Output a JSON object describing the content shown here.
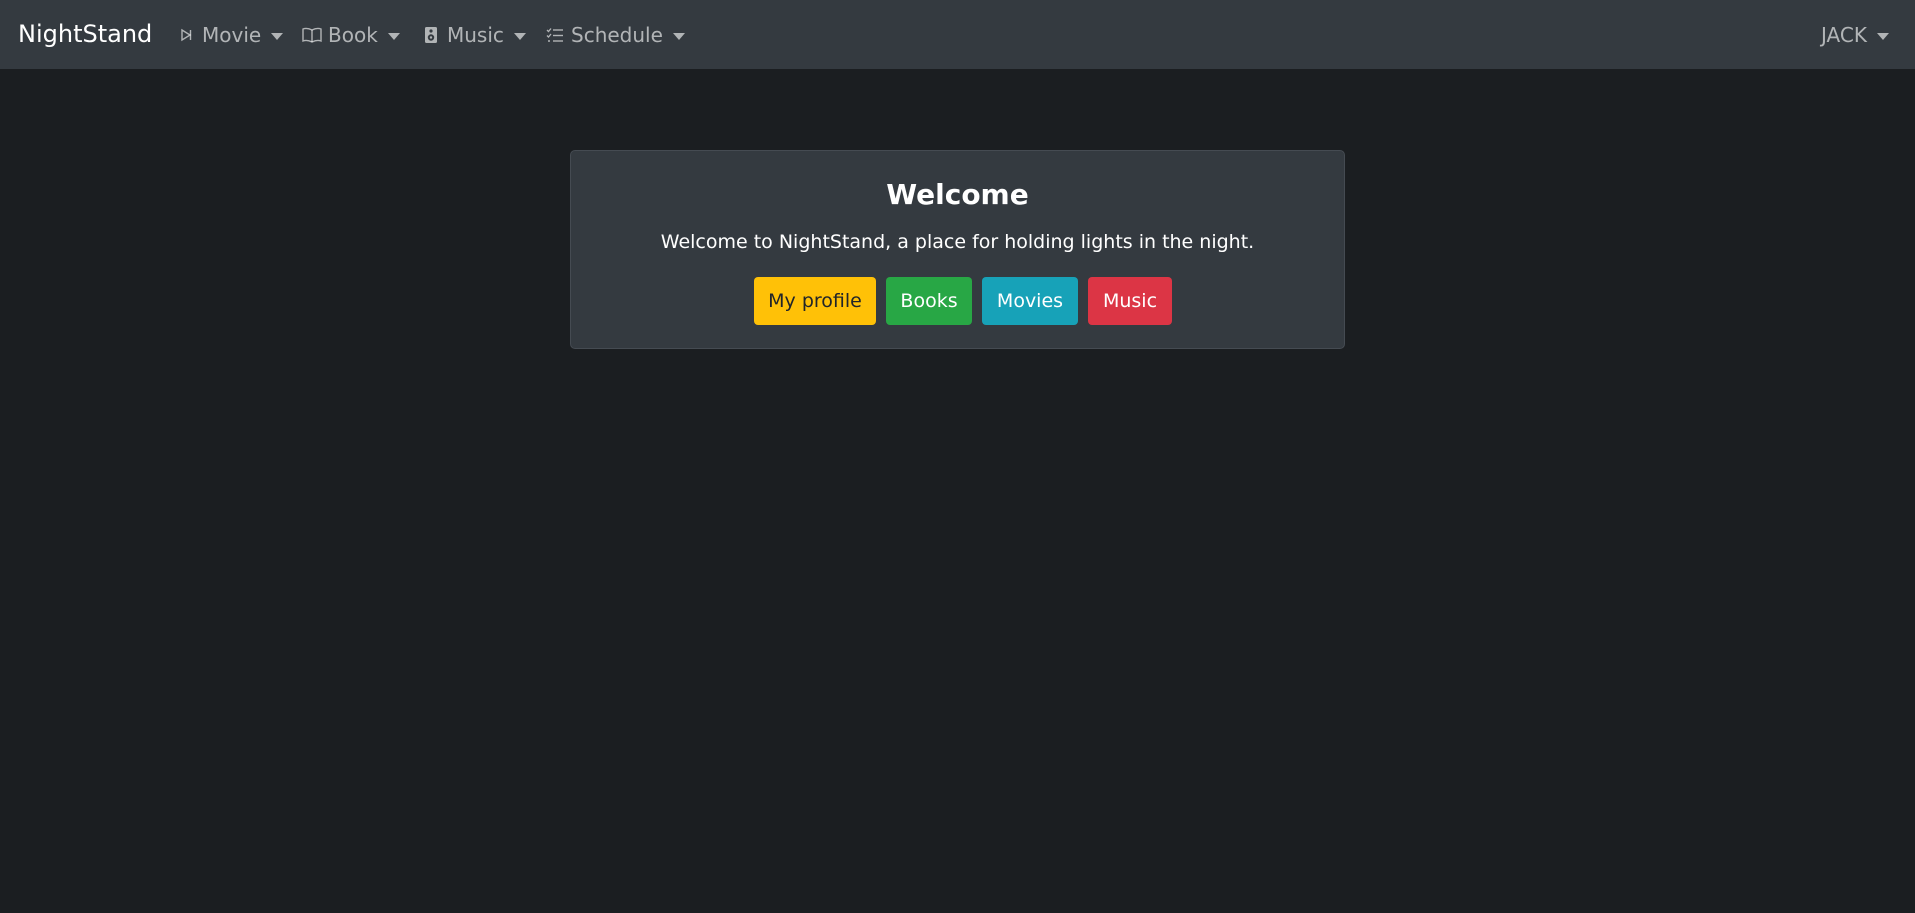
{
  "navbar": {
    "brand": "NightStand",
    "items": [
      {
        "label": "Movie",
        "icon": "play-icon"
      },
      {
        "label": "Book",
        "icon": "book-icon"
      },
      {
        "label": "Music",
        "icon": "speaker-icon"
      },
      {
        "label": "Schedule",
        "icon": "list-icon"
      }
    ],
    "user": "JACK"
  },
  "welcome": {
    "title": "Welcome",
    "text": "Welcome to NightStand, a place for holding lights in the night.",
    "buttons": {
      "profile": "My profile",
      "books": "Books",
      "movies": "Movies",
      "music": "Music"
    }
  },
  "colors": {
    "background": "#1b1e21",
    "navbar": "#343a40",
    "card": "#343a40",
    "warning": "#ffc107",
    "success": "#28a745",
    "info": "#17a2b8",
    "danger": "#dc3545"
  }
}
